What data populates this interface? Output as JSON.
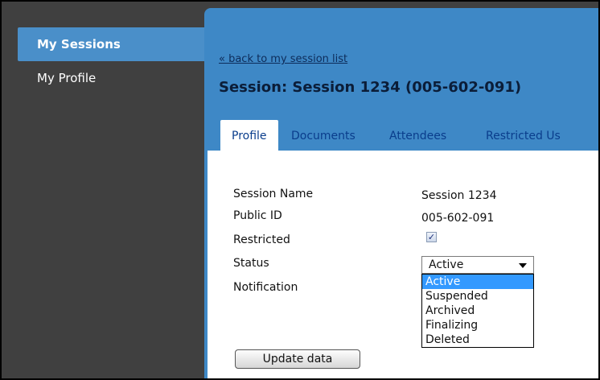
{
  "sidebar": {
    "items": [
      {
        "label": "My Sessions",
        "active": true
      },
      {
        "label": "My Profile",
        "active": false
      }
    ]
  },
  "main": {
    "back_link": "« back to my session list",
    "title": "Session: Session 1234 (005-602-091)",
    "tabs": [
      {
        "label": "Profile",
        "active": true
      },
      {
        "label": "Documents",
        "active": false
      },
      {
        "label": "Attendees",
        "active": false
      },
      {
        "label": "Restricted Us",
        "active": false
      }
    ]
  },
  "form": {
    "session_name": {
      "label": "Session Name",
      "value": "Session 1234"
    },
    "public_id": {
      "label": "Public ID",
      "value": "005-602-091"
    },
    "restricted": {
      "label": "Restricted",
      "checked": true,
      "check_glyph": "✓"
    },
    "status": {
      "label": "Status",
      "selected": "Active",
      "options": [
        "Active",
        "Suspended",
        "Archived",
        "Finalizing",
        "Deleted"
      ],
      "highlighted_index": 0
    },
    "notification": {
      "label": "Notification"
    },
    "update_button": "Update data"
  },
  "colors": {
    "sidebar_bg": "#404040",
    "sidebar_active": "#4a8fc9",
    "main_bg": "#3e88c6",
    "link": "#0d2c5a",
    "tab_text": "#0a3d8c",
    "option_highlight": "#3399ff"
  }
}
